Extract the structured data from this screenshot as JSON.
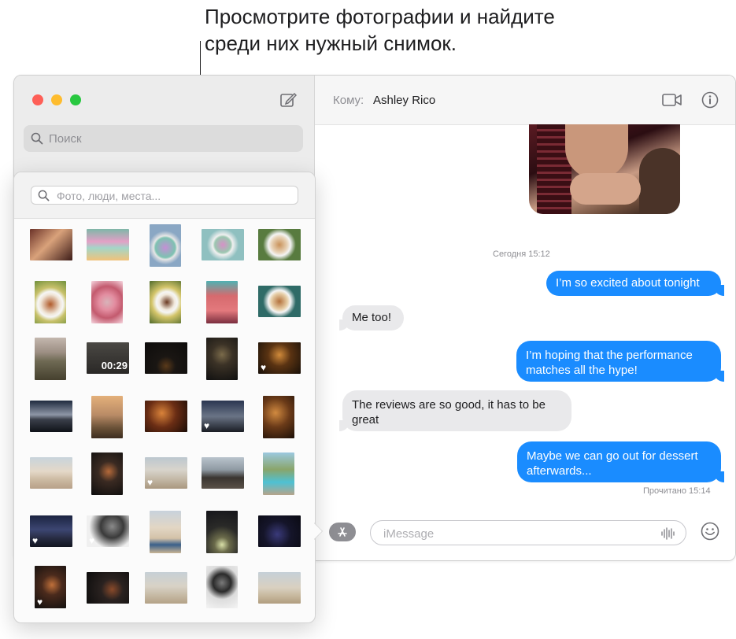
{
  "callout": {
    "line1": "Просмотрите фотографии и найдите",
    "line2": "среди них нужный снимок."
  },
  "sidebar": {
    "search_placeholder": "Поиск",
    "icons": [
      "close-button",
      "minimize-button",
      "zoom-button",
      "compose-icon",
      "search-icon"
    ]
  },
  "header": {
    "to_label": "Кому:",
    "recipient": "Ashley Rico",
    "icons": [
      "video-camera-icon",
      "info-icon"
    ]
  },
  "conversation": {
    "timestamp": "Сегодня 15:12",
    "messages": [
      {
        "from": "me",
        "text": "I’m so excited about tonight"
      },
      {
        "from": "them",
        "text": "Me too!"
      },
      {
        "from": "me",
        "text": "I’m hoping that the performance matches all the hype!"
      },
      {
        "from": "them",
        "text": "The reviews are so good, it has to be great"
      },
      {
        "from": "me",
        "text": "Maybe we can go out for dessert afterwards..."
      }
    ],
    "read_receipt": "Прочитано 15:14"
  },
  "composer": {
    "placeholder": "iMessage",
    "icons": [
      "app-store-icon",
      "audio-waveform-icon",
      "emoji-icon"
    ]
  },
  "photo_picker": {
    "search_placeholder": "Фото, люди, места...",
    "video_duration": "00:29",
    "colors": [
      "#5b2a2a",
      "#7fb7a8",
      "#8aa7c4",
      "#8fc0c0",
      "#587b3f"
    ]
  }
}
